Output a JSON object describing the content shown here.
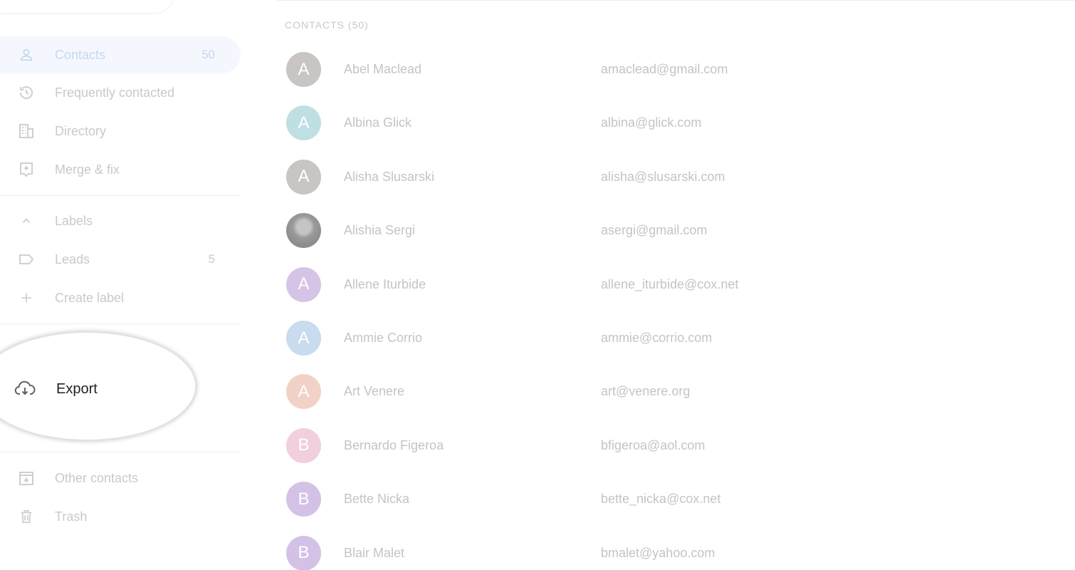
{
  "sidebar": {
    "contacts": {
      "label": "Contacts",
      "count": "50"
    },
    "frequent": {
      "label": "Frequently contacted"
    },
    "directory": {
      "label": "Directory"
    },
    "merge": {
      "label": "Merge & fix"
    },
    "labels_header": {
      "label": "Labels"
    },
    "leads": {
      "label": "Leads",
      "count": "5"
    },
    "create_label": {
      "label": "Create label"
    },
    "export": {
      "label": "Export"
    },
    "other_contacts": {
      "label": "Other contacts"
    },
    "trash": {
      "label": "Trash"
    }
  },
  "main": {
    "section_title": "CONTACTS (50)",
    "contacts": [
      {
        "initial": "A",
        "name": "Abel Maclead",
        "email": "amaclead@gmail.com",
        "color": "#c8c5c2"
      },
      {
        "initial": "A",
        "name": "Albina Glick",
        "email": "albina@glick.com",
        "color": "#bfe0e2"
      },
      {
        "initial": "A",
        "name": "Alisha Slusarski",
        "email": "alisha@slusarski.com",
        "color": "#c8c5c2"
      },
      {
        "initial": "",
        "name": "Alishia Sergi",
        "email": "asergi@gmail.com",
        "color": "#9a9a9a",
        "photo": true
      },
      {
        "initial": "A",
        "name": "Allene Iturbide",
        "email": "allene_iturbide@cox.net",
        "color": "#d6c4e6"
      },
      {
        "initial": "A",
        "name": "Ammie Corrio",
        "email": "ammie@corrio.com",
        "color": "#c8dbef"
      },
      {
        "initial": "A",
        "name": "Art Venere",
        "email": "art@venere.org",
        "color": "#f2d2c6"
      },
      {
        "initial": "B",
        "name": "Bernardo Figeroa",
        "email": "bfigeroa@aol.com",
        "color": "#f1cfdc"
      },
      {
        "initial": "B",
        "name": "Bette Nicka",
        "email": "bette_nicka@cox.net",
        "color": "#d3c2e6"
      },
      {
        "initial": "B",
        "name": "Blair Malet",
        "email": "bmalet@yahoo.com",
        "color": "#d3c2e6"
      }
    ]
  }
}
